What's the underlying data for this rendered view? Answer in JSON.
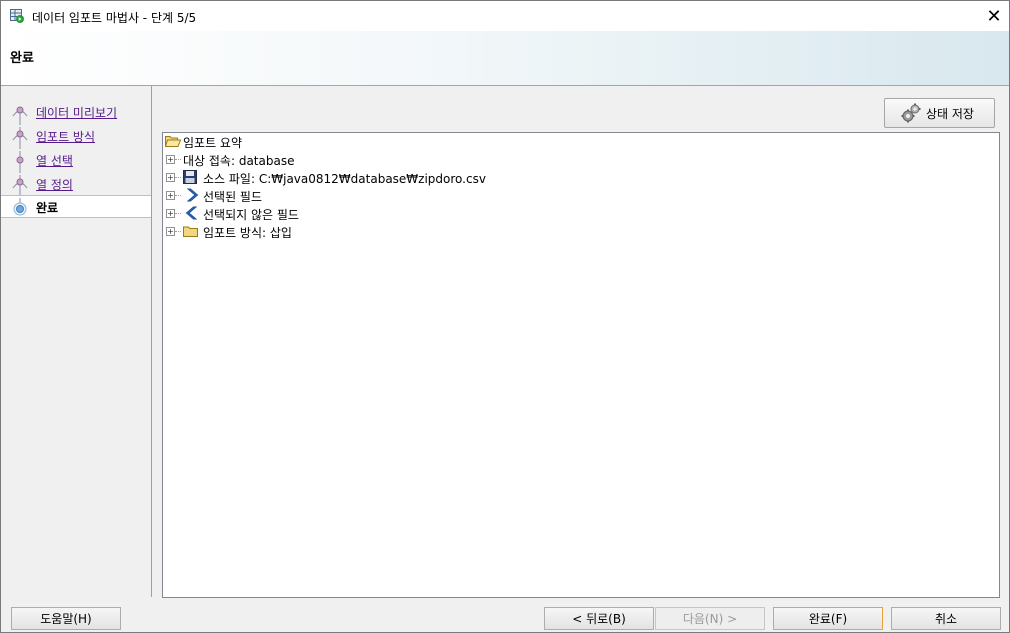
{
  "window": {
    "title": "데이터 임포트 마법사 - 단계 5/5",
    "close_glyph": "✕",
    "app_icon": "table-import-icon"
  },
  "header": {
    "title": "완료"
  },
  "steps": [
    {
      "label": "데이터 미리보기",
      "state": "visited"
    },
    {
      "label": "임포트 방식",
      "state": "visited"
    },
    {
      "label": "열 선택",
      "state": "visited"
    },
    {
      "label": "열 정의",
      "state": "visited"
    },
    {
      "label": "완료",
      "state": "current"
    }
  ],
  "toolbar": {
    "save_state_label": "상태 저장",
    "save_state_icon": "gears-icon"
  },
  "tree": {
    "root": {
      "label": "임포트 요약",
      "icon": "folder-open-icon"
    },
    "items": [
      {
        "label": "대상 접속: database",
        "icon": ""
      },
      {
        "label": "소스 파일: C:₩java0812₩database₩zipdoro.csv",
        "icon": "floppy-disk-icon"
      },
      {
        "label": "선택된 필드",
        "icon": "chevron-right-icon"
      },
      {
        "label": "선택되지 않은 필드",
        "icon": "chevron-left-icon"
      },
      {
        "label": "임포트 방식: 삽입",
        "icon": "folder-icon"
      }
    ]
  },
  "buttons": {
    "help": "도움말(H)",
    "back": "< 뒤로(B)",
    "next": "다음(N) >",
    "finish": "완료(F)",
    "cancel": "취소"
  },
  "colors": {
    "visited_link": "#551a8b",
    "header_gradient_end": "#d8e8ee",
    "default_button_border": "#e8a43c"
  }
}
